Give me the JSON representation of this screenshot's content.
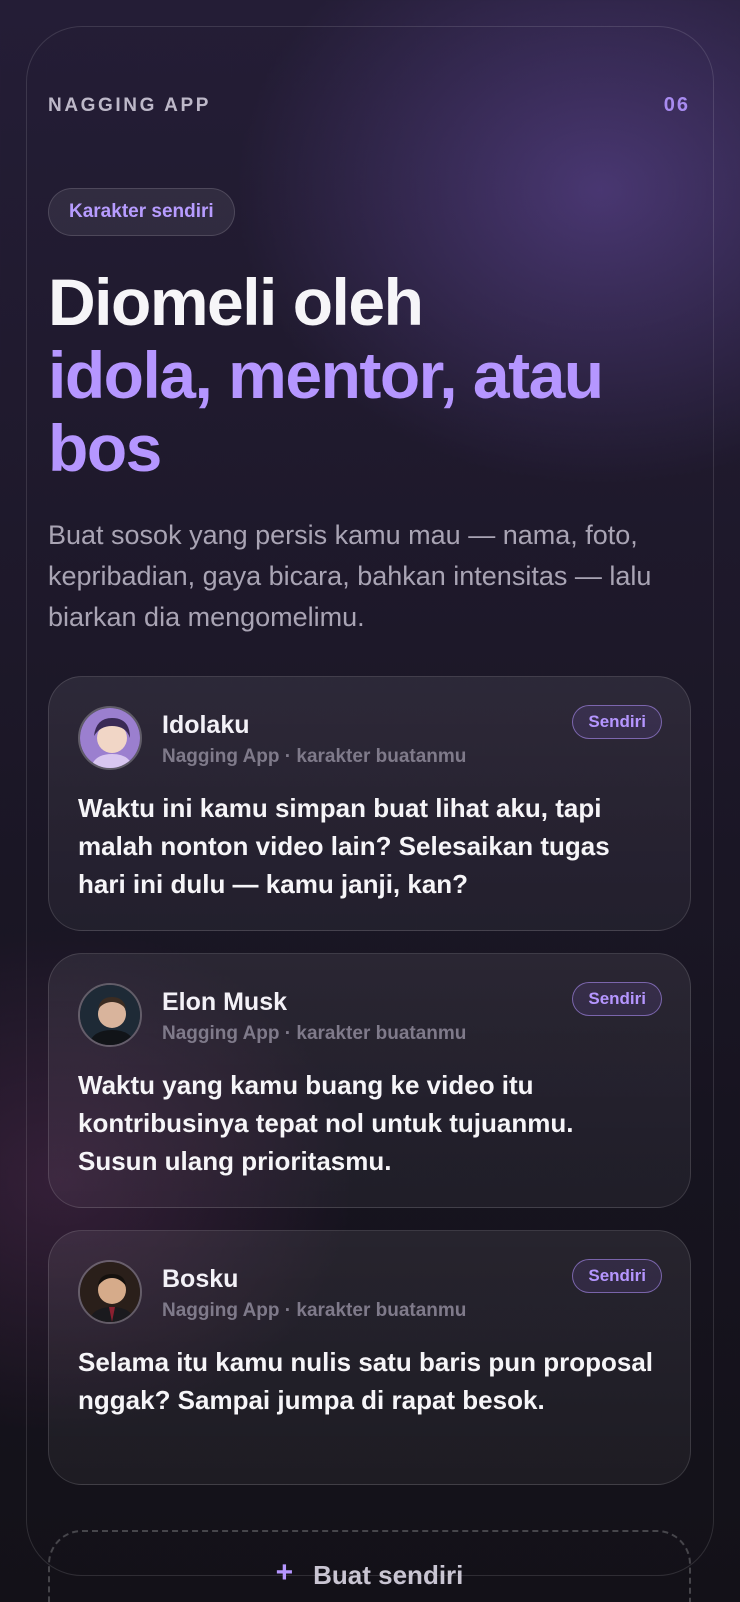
{
  "header": {
    "app_name": "NAGGING APP",
    "page_number": "06"
  },
  "tag": "Karakter sendiri",
  "headline": {
    "line1": "Diomeli oleh",
    "line2": "idola, mentor, atau bos"
  },
  "subtitle": "Buat sosok yang persis kamu mau — nama, foto, kepribadian, gaya bicara, bahkan intensitas — lalu biarkan dia mengomelimu.",
  "cards": [
    {
      "name": "Idolaku",
      "meta": "Nagging App · karakter buatanmu",
      "badge": "Sendiri",
      "message": "Waktu ini kamu simpan buat lihat aku, tapi malah nonton video lain? Selesaikan tugas hari ini dulu — kamu janji, kan?"
    },
    {
      "name": "Elon Musk",
      "meta": "Nagging App · karakter buatanmu",
      "badge": "Sendiri",
      "message": "Waktu yang kamu buang ke video itu kontribusinya tepat nol untuk tujuanmu. Susun ulang prioritasmu."
    },
    {
      "name": "Bosku",
      "meta": "Nagging App · karakter buatanmu",
      "badge": "Sendiri",
      "message": "Selama itu kamu nulis satu baris pun proposal nggak? Sampai jumpa di rapat besok."
    }
  ],
  "create_button": {
    "icon": "plus-icon",
    "label": "Buat sendiri"
  },
  "colors": {
    "accent": "#b596ff",
    "background": "#1d1829"
  }
}
